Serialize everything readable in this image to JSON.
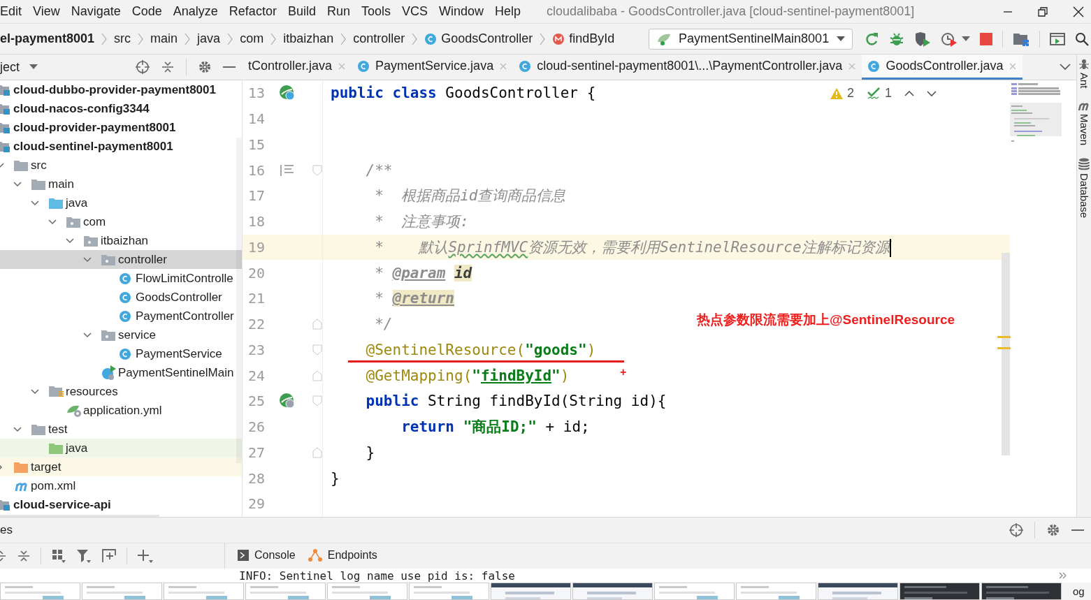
{
  "menu": [
    "Edit",
    "View",
    "Navigate",
    "Code",
    "Analyze",
    "Refactor",
    "Build",
    "Run",
    "Tools",
    "VCS",
    "Window",
    "Help"
  ],
  "window": {
    "title": "cloudalibaba - GoodsController.java [cloud-sentinel-payment8001]"
  },
  "breadcrumb": [
    {
      "label": "el-payment8001",
      "kind": "module"
    },
    {
      "label": "src",
      "kind": "dir"
    },
    {
      "label": "main",
      "kind": "dir"
    },
    {
      "label": "java",
      "kind": "dir"
    },
    {
      "label": "com",
      "kind": "dir"
    },
    {
      "label": "itbaizhan",
      "kind": "dir"
    },
    {
      "label": "controller",
      "kind": "dir"
    },
    {
      "label": "GoodsController",
      "kind": "class"
    },
    {
      "label": "findById",
      "kind": "method"
    }
  ],
  "run_config": {
    "label": "PaymentSentinelMain8001"
  },
  "project_panel": {
    "title": "ject"
  },
  "tree": [
    {
      "label": "cloud-dubbo-provider-payment8001",
      "kind": "module",
      "selected": false
    },
    {
      "label": "cloud-nacos-config3344",
      "kind": "module",
      "selected": false
    },
    {
      "label": "cloud-provider-payment8001",
      "kind": "module",
      "selected": false
    },
    {
      "label": "cloud-sentinel-payment8001",
      "kind": "module",
      "selected": false,
      "children": [
        {
          "label": "src",
          "kind": "folder",
          "expanded": true,
          "selected": false,
          "children": [
            {
              "label": "main",
              "kind": "folder",
              "expanded": true,
              "selected": false,
              "children": [
                {
                  "label": "java",
                  "kind": "source-root",
                  "expanded": true,
                  "selected": false,
                  "children": [
                    {
                      "label": "com",
                      "kind": "package",
                      "expanded": true,
                      "selected": false,
                      "children": [
                        {
                          "label": "itbaizhan",
                          "kind": "package",
                          "expanded": true,
                          "selected": false,
                          "children": [
                            {
                              "label": "controller",
                              "kind": "package",
                              "expanded": true,
                              "selected": true,
                              "children": [
                                {
                                  "label": "FlowLimitControlle",
                                  "kind": "class",
                                  "selected": false
                                },
                                {
                                  "label": "GoodsController",
                                  "kind": "class",
                                  "selected": false
                                },
                                {
                                  "label": "PaymentController",
                                  "kind": "class",
                                  "selected": false
                                }
                              ]
                            },
                            {
                              "label": "service",
                              "kind": "package",
                              "expanded": true,
                              "selected": false,
                              "children": [
                                {
                                  "label": "PaymentService",
                                  "kind": "class",
                                  "selected": false
                                }
                              ]
                            },
                            {
                              "label": "PaymentSentinelMain",
                              "kind": "main-class",
                              "selected": false
                            }
                          ]
                        }
                      ]
                    }
                  ]
                },
                {
                  "label": "resources",
                  "kind": "resources",
                  "expanded": true,
                  "selected": false,
                  "children": [
                    {
                      "label": "application.yml",
                      "kind": "yaml",
                      "selected": false
                    }
                  ]
                }
              ]
            },
            {
              "label": "test",
              "kind": "folder",
              "expanded": true,
              "selected": false,
              "children": [
                {
                  "label": "java",
                  "kind": "test-root",
                  "selected": false
                }
              ]
            }
          ]
        },
        {
          "label": "target",
          "kind": "excluded",
          "expanded": false,
          "selected": false
        },
        {
          "label": "pom.xml",
          "kind": "maven",
          "selected": false
        }
      ]
    },
    {
      "label": "cloud-service-api",
      "kind": "module",
      "selected": false
    }
  ],
  "editor_tabs": [
    {
      "label": "tController.java",
      "kind": "clipped",
      "selected": false
    },
    {
      "label": "PaymentService.java",
      "kind": "class",
      "selected": false
    },
    {
      "label": "cloud-sentinel-payment8001\\...\\PaymentController.java",
      "kind": "class",
      "selected": false
    },
    {
      "label": "GoodsController.java",
      "kind": "class",
      "selected": true
    }
  ],
  "editor": {
    "inspections": {
      "warnings": "2",
      "typos": "1"
    },
    "note": "热点参数限流需要加上@SentinelResource",
    "lines": [
      {
        "number": "13",
        "gutter": {
          "kind": "bean"
        },
        "tokens": [
          {
            "text": "public",
            "kind": "kw"
          },
          {
            "text": " class",
            "kind": "kw"
          },
          {
            "text": " GoodsController {",
            "kind": "plain"
          }
        ]
      },
      {
        "number": "14"
      },
      {
        "number": "15"
      },
      {
        "number": "16",
        "gutter": {
          "kind": "reader"
        },
        "fold": {
          "kind": "start"
        },
        "tokens": [
          {
            "text": "    /**",
            "kind": "comment"
          }
        ]
      },
      {
        "number": "17",
        "tokens": [
          {
            "text": "     *  根据商品id查询商品信息",
            "kind": "comment"
          }
        ]
      },
      {
        "number": "18",
        "tokens": [
          {
            "text": "     *  注意事项:",
            "kind": "comment"
          }
        ]
      },
      {
        "number": "19",
        "current": true,
        "caret": true,
        "tokens": [
          {
            "text": "     *    默认",
            "kind": "comment"
          },
          {
            "text": "SprinfMVC",
            "kind": "typo"
          },
          {
            "text": "资源无效，需要利用SentinelResource注解标记资源",
            "kind": "comment"
          }
        ]
      },
      {
        "number": "20",
        "tokens": [
          {
            "text": "     * ",
            "kind": "comment"
          },
          {
            "text": "@param",
            "kind": "doctag",
            "marked": false
          },
          {
            "text": "id",
            "kind": "docparam",
            "marked": true
          }
        ]
      },
      {
        "number": "21",
        "tokens": [
          {
            "text": "     * ",
            "kind": "comment"
          },
          {
            "text": "@return",
            "kind": "doctag",
            "marked": true
          }
        ]
      },
      {
        "number": "22",
        "fold": {
          "kind": "end"
        },
        "tokens": [
          {
            "text": "     */",
            "kind": "comment"
          }
        ]
      },
      {
        "number": "23",
        "fold": {
          "kind": "start"
        },
        "underlined": true,
        "tokens": [
          {
            "text": "    @SentinelResource(",
            "kind": "annotation"
          },
          {
            "text": "\"goods\"",
            "kind": "string"
          },
          {
            "text": ")",
            "kind": "annotation"
          }
        ]
      },
      {
        "number": "24",
        "fold": {
          "kind": "end"
        },
        "mark": "+",
        "tokens": [
          {
            "text": "    @GetMapping(",
            "kind": "annotation"
          },
          {
            "text": "\"",
            "kind": "string"
          },
          {
            "text": "findById",
            "kind": "string-link"
          },
          {
            "text": "\"",
            "kind": "string"
          },
          {
            "text": ")",
            "kind": "annotation"
          }
        ]
      },
      {
        "number": "25",
        "gutter": {
          "kind": "bean-web"
        },
        "fold": {
          "kind": "start"
        },
        "tokens": [
          {
            "text": "    public",
            "kind": "kw"
          },
          {
            "text": " String findById(String id){",
            "kind": "plain"
          }
        ]
      },
      {
        "number": "26",
        "tokens": [
          {
            "text": "        return",
            "kind": "kw"
          },
          {
            "text": " \"商品ID;\"",
            "kind": "string"
          },
          {
            "text": " + id;",
            "kind": "plain"
          }
        ]
      },
      {
        "number": "27",
        "fold": {
          "kind": "end"
        },
        "tokens": [
          {
            "text": "    }",
            "kind": "plain"
          }
        ]
      },
      {
        "number": "28",
        "tokens": [
          {
            "text": "}",
            "kind": "plain"
          }
        ]
      },
      {
        "number": "29"
      }
    ]
  },
  "side_tools": [
    {
      "label": "Ant",
      "kind": "ant"
    },
    {
      "label": "Maven",
      "kind": "maven"
    },
    {
      "label": "Database",
      "kind": "database"
    }
  ],
  "bottom_panel": {
    "title": "es",
    "tabs": [
      {
        "label": "Console",
        "kind": "console",
        "selected": false
      },
      {
        "label": "Endpoints",
        "kind": "endpoints",
        "selected": false
      }
    ],
    "console_line": "INFO: Sentinel log name use pid is: false"
  },
  "taskbar": {
    "thumbnails": [
      {
        "kind": "light"
      },
      {
        "kind": "light"
      },
      {
        "kind": "light"
      },
      {
        "kind": "light"
      },
      {
        "kind": "light"
      },
      {
        "kind": "light"
      },
      {
        "kind": "screen"
      },
      {
        "kind": "screen"
      },
      {
        "kind": "light"
      },
      {
        "kind": "light"
      },
      {
        "kind": "screen"
      },
      {
        "kind": "dark"
      },
      {
        "kind": "dark"
      }
    ],
    "label": "og"
  }
}
